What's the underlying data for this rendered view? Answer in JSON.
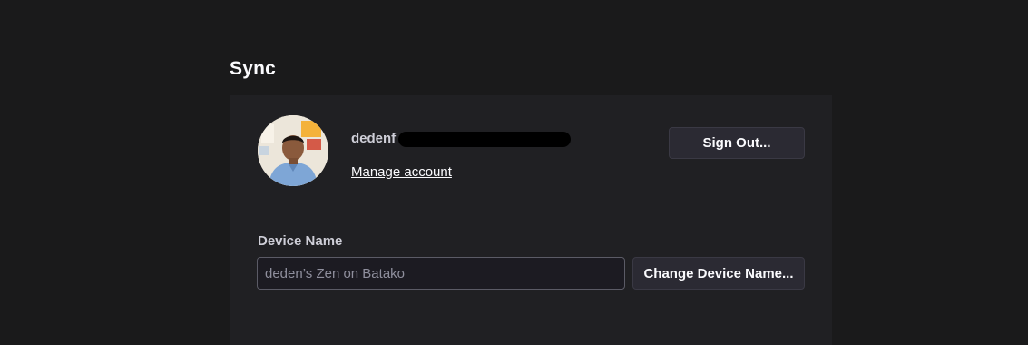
{
  "section": {
    "title": "Sync"
  },
  "account": {
    "name": "dedenf",
    "manage_link": "Manage account",
    "sign_out_label": "Sign Out..."
  },
  "device": {
    "label": "Device Name",
    "placeholder": "deden’s Zen on Batako",
    "change_label": "Change Device Name..."
  }
}
